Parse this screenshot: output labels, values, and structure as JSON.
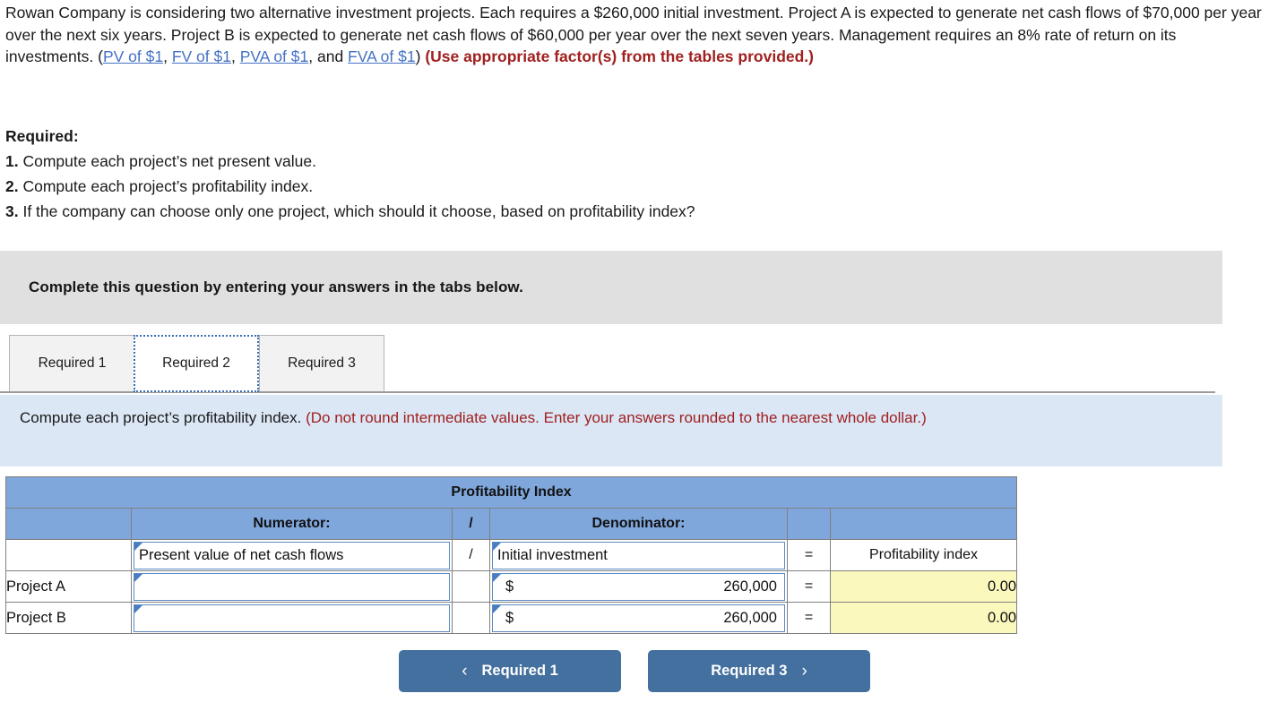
{
  "intro": {
    "part1": "Rowan Company is considering two alternative investment projects. Each requires a $260,000 initial investment. Project A is expected to generate net cash flows of $70,000 per year over the next six years. Project B is expected to generate net cash flows of $60,000 per year over the next seven years. Management requires an 8% rate of return on its investments. (",
    "link1": "PV of $1",
    "sep1": ", ",
    "link2": "FV of $1",
    "sep2": ", ",
    "link3": "PVA of $1",
    "sep3": ", and ",
    "link4": "FVA of $1",
    "part2": ") ",
    "note": "(Use appropriate factor(s) from the tables provided.)"
  },
  "required": {
    "heading": "Required:",
    "items": [
      {
        "num": "1.",
        "text": " Compute each project’s net present value."
      },
      {
        "num": "2.",
        "text": " Compute each project’s profitability index."
      },
      {
        "num": "3.",
        "text": " If the company can choose only one project, which should it choose, based on profitability index?"
      }
    ]
  },
  "banner": {
    "text": "Complete this question by entering your answers in the tabs below."
  },
  "tabs": [
    {
      "label": "Required 1",
      "active": false
    },
    {
      "label": "Required 2",
      "active": true
    },
    {
      "label": "Required 3",
      "active": false
    }
  ],
  "instruction": {
    "main": "Compute each project’s profitability index. ",
    "hint": "(Do not round intermediate values. Enter your answers rounded to the nearest whole dollar.)"
  },
  "table": {
    "title": "Profitability Index",
    "headers": {
      "blank_left": "",
      "numerator": "Numerator:",
      "divide": "/",
      "denominator": "Denominator:",
      "blank_eq": "",
      "blank_right": ""
    },
    "label_row": {
      "blank_left": "",
      "numerator": "Present value of net cash flows",
      "divide": "/",
      "denominator": "Initial investment",
      "equals": "=",
      "result": "Profitability index"
    },
    "rows": [
      {
        "label": "Project A",
        "numerator_value": "",
        "divide": "",
        "denom_currency": "$",
        "denom_value": "260,000",
        "equals": "=",
        "result": "0.00"
      },
      {
        "label": "Project B",
        "numerator_value": "",
        "divide": "",
        "denom_currency": "$",
        "denom_value": "260,000",
        "equals": "=",
        "result": "0.00"
      }
    ]
  },
  "nav": {
    "prev_chevron": "‹",
    "prev_label": "Required 1",
    "next_label": "Required 3",
    "next_chevron": "›"
  },
  "colors": {
    "header_blue": "#7fa7dc",
    "panel_blue": "#dbe7f5",
    "banner_gray": "#e0e0e0",
    "answer_yellow": "#fbf8bd",
    "button_blue": "#44709f",
    "link_blue": "#4472c4",
    "red_note": "#a02020"
  }
}
